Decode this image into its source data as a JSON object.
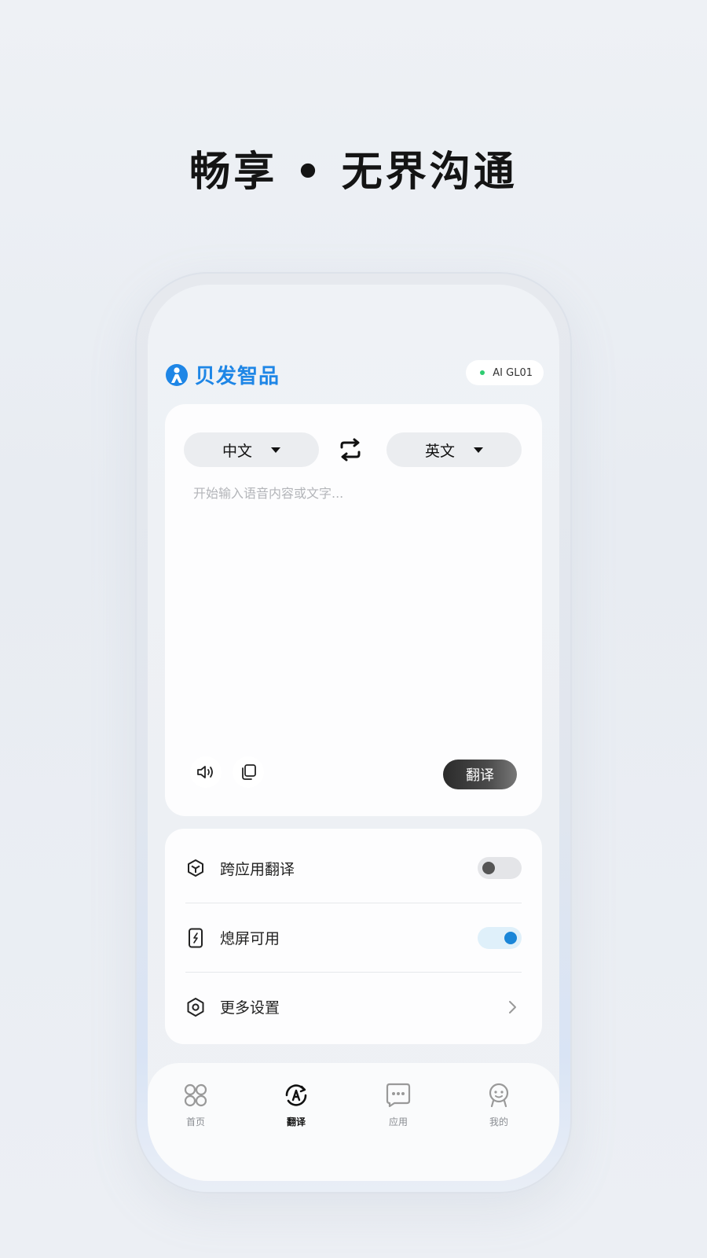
{
  "headline": "畅享 • 无界沟通",
  "brand": {
    "name": "贝发智品",
    "color": "#1e86e6"
  },
  "device": {
    "label": "AI GL01",
    "status_color": "#2ecc71"
  },
  "translator": {
    "source_lang": "中文",
    "target_lang": "英文",
    "input_value": "",
    "input_placeholder": "开始输入语音内容或文字...",
    "translate_label": "翻译"
  },
  "settings": {
    "items": [
      {
        "label": "跨应用翻译",
        "icon": "cube-icon",
        "control": "toggle",
        "on": false
      },
      {
        "label": "熄屏可用",
        "icon": "phone-flash-icon",
        "control": "toggle",
        "on": true
      },
      {
        "label": "更多设置",
        "icon": "hexagon-gear-icon",
        "control": "chevron"
      }
    ],
    "toggle_on_color": "#1a86d8"
  },
  "tabs": [
    {
      "label": "首页",
      "icon": "grid-icon",
      "active": false
    },
    {
      "label": "翻译",
      "icon": "translate-icon",
      "active": true
    },
    {
      "label": "应用",
      "icon": "chat-dots-icon",
      "active": false
    },
    {
      "label": "我的",
      "icon": "person-icon",
      "active": false
    }
  ]
}
